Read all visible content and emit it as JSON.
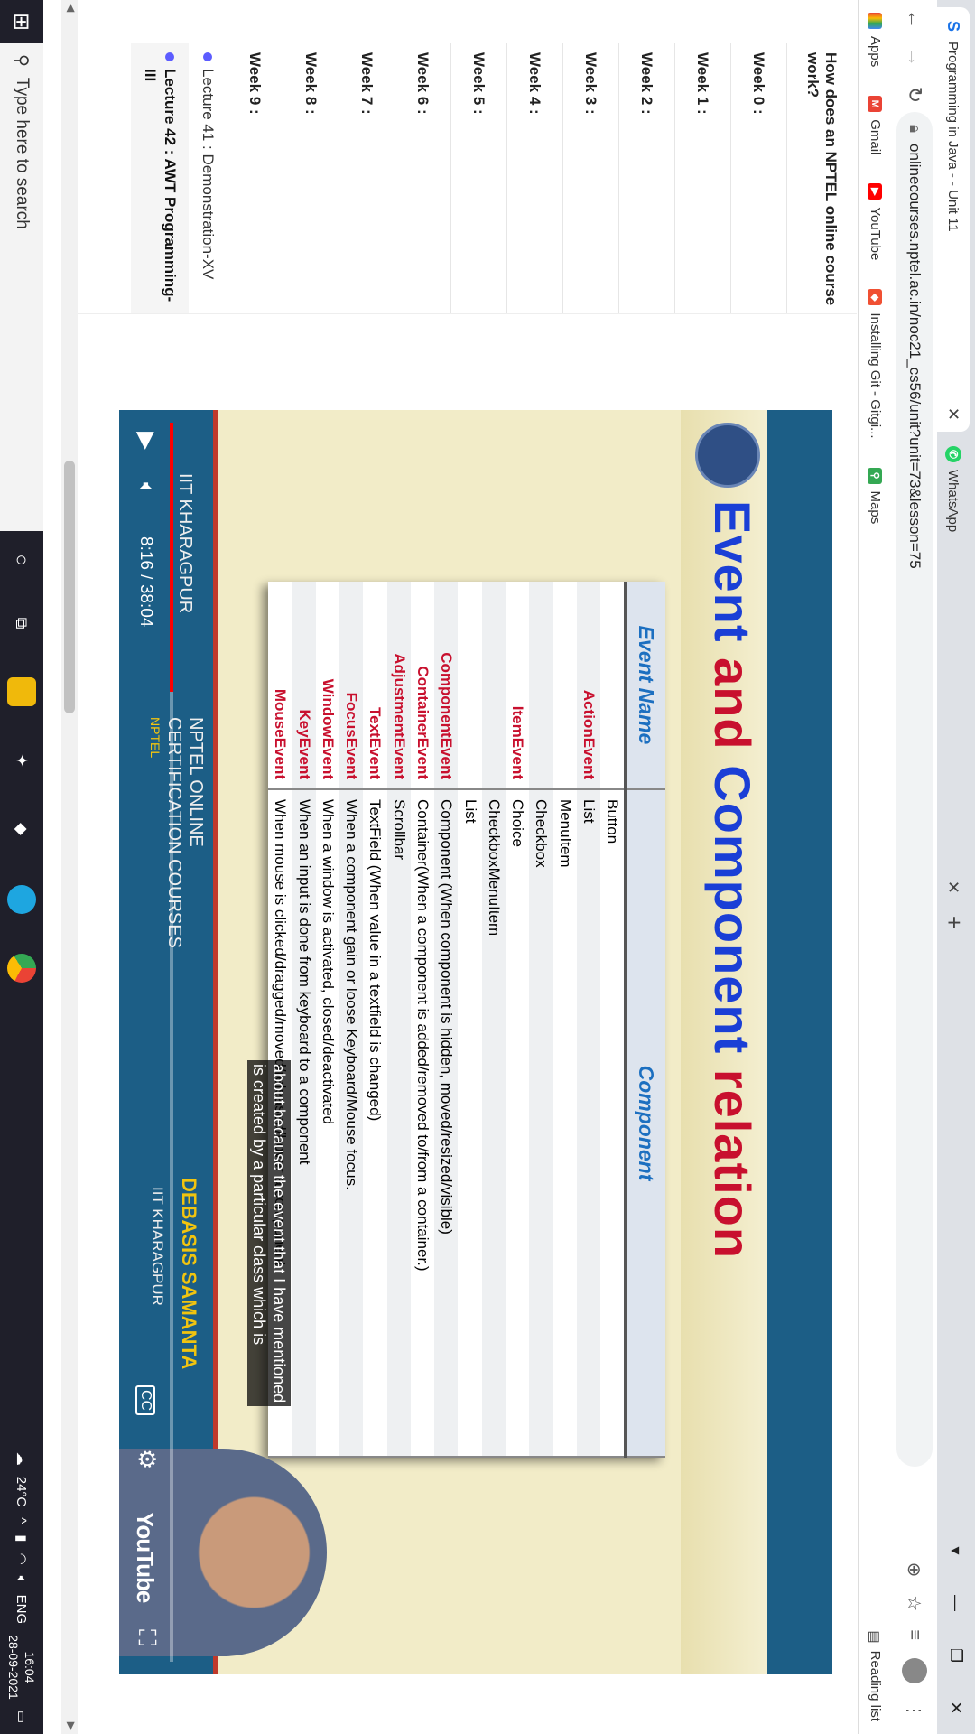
{
  "browser": {
    "tabs": [
      {
        "title": "Programming in Java - - Unit 11",
        "icon": "nptel-icon",
        "active": true
      },
      {
        "title": "WhatsApp",
        "icon": "whatsapp-icon",
        "active": false
      }
    ],
    "url": "onlinecourses.nptel.ac.in/noc21_cs56/unit?unit=73&lesson=75",
    "bookmarks": [
      "Apps",
      "Gmail",
      "YouTube",
      "Installing Git - Gitgi...",
      "Maps"
    ],
    "reading_list": "Reading list"
  },
  "sidebar": {
    "intro": "How does an NPTEL online course work?",
    "weeks": [
      "Week 0 :",
      "Week 1 :",
      "Week 2 :",
      "Week 3 :",
      "Week 4 :",
      "Week 5 :",
      "Week 6 :",
      "Week 7 :",
      "Week 8 :",
      "Week 9 :"
    ],
    "lectures": [
      {
        "label": "Lecture 41 : Demonstration-XV"
      },
      {
        "label": "Lecture 42 : AWT Programming-III"
      }
    ]
  },
  "slide": {
    "title_part1": "Event",
    "title_and1": "and",
    "title_part2": "Component",
    "title_part3": "relation",
    "col_event": "Event Name",
    "col_component": "Component",
    "rows": [
      {
        "event": "",
        "component": "Button"
      },
      {
        "event": "ActionEvent",
        "component": "List"
      },
      {
        "event": "",
        "component": "MenuItem"
      },
      {
        "event": "",
        "component": "Checkbox"
      },
      {
        "event": "ItemEvent",
        "component": "Choice"
      },
      {
        "event": "",
        "component": "CheckboxMenuItem"
      },
      {
        "event": "",
        "component": "List"
      },
      {
        "event": "ComponentEvent",
        "component": "Component (When component is hidden, moved/resized/visible)"
      },
      {
        "event": "ContainerEvent",
        "component": "Container(When a component is added/removed to/from a container.)"
      },
      {
        "event": "AdjustmentEvent",
        "component": "Scrollbar"
      },
      {
        "event": "TextEvent",
        "component": "TextField (When value in a textfield is changed)"
      },
      {
        "event": "FocusEvent",
        "component": "When a component gain or loose Keyboard/Mouse focus."
      },
      {
        "event": "WindowEvent",
        "component": "When a window is activated, closed/deactivated"
      },
      {
        "event": "KeyEvent",
        "component": "When an input is done from keyboard to a component"
      },
      {
        "event": "MouseEvent",
        "component": "When mouse is clicked/dragged/moved/released/hover a component"
      }
    ],
    "footer_left": "IIT KHARAGPUR",
    "footer_center1": "NPTEL ONLINE",
    "footer_center2": "CERTIFICATION COURSES",
    "footer_nptel": "NPTEL",
    "presenter": "DEBASIS SAMANTA",
    "presenter_inst": "IIT KHARAGPUR",
    "caption1": "about because the event that I have mentioned",
    "caption2": "is created by a particular class which is"
  },
  "player": {
    "time": "8:16 / 38:04",
    "progress": 0.217,
    "cc": "CC",
    "brand": "YouTube"
  },
  "taskbar": {
    "search_placeholder": "Type here to search",
    "weather": "24°C",
    "lang": "ENG",
    "time": "16:04",
    "date": "28-09-2021"
  },
  "colors": {
    "slide_bg": "#f2ecc8",
    "title_blue": "#1a3fd6",
    "title_red": "#c8102e",
    "footer_blue": "#1c5e86",
    "progress_red": "#ff0000"
  }
}
